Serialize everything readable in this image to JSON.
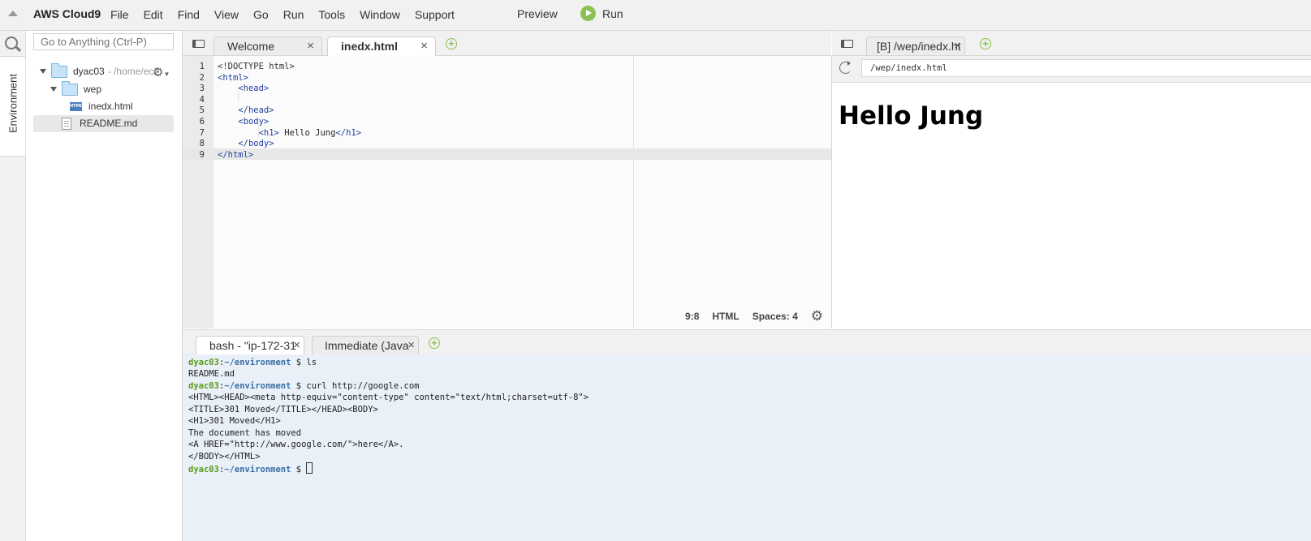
{
  "menubar": {
    "brand": "AWS Cloud9",
    "items": [
      "File",
      "Edit",
      "Find",
      "View",
      "Go",
      "Run",
      "Tools",
      "Window",
      "Support"
    ],
    "preview": "Preview",
    "run": "Run"
  },
  "sidebar": {
    "env_tab": "Environment",
    "search_placeholder": "Go to Anything (Ctrl-P)"
  },
  "tree": {
    "root_name": "dyac03",
    "root_path": "- /home/ec2",
    "folder": "wep",
    "file_html": "inedx.html",
    "file_readme": "README.md"
  },
  "editor": {
    "tabs": [
      {
        "label": "Welcome",
        "active": false
      },
      {
        "label": "inedx.html",
        "active": true
      }
    ],
    "lines": [
      {
        "n": "1",
        "text": "<!DOCTYPE html>"
      },
      {
        "n": "2",
        "text": "<html>"
      },
      {
        "n": "3",
        "text": "    <head>"
      },
      {
        "n": "4",
        "text": ""
      },
      {
        "n": "5",
        "text": "    </head>"
      },
      {
        "n": "6",
        "text": "    <body>"
      },
      {
        "n": "7",
        "text": "        <h1> Hello Jung</h1>"
      },
      {
        "n": "8",
        "text": "    </body>"
      },
      {
        "n": "9",
        "text": "</html>"
      }
    ],
    "status": {
      "position": "9:8",
      "mode": "HTML",
      "spaces": "Spaces: 4"
    }
  },
  "preview": {
    "tab_label": "[B] /wep/inedx.ht",
    "address": "/wep/inedx.html",
    "heading": "Hello Jung"
  },
  "terminal": {
    "tabs": [
      {
        "label": "bash - \"ip-172-31"
      },
      {
        "label": "Immediate (Java"
      }
    ],
    "user": "dyac03",
    "path": "~/environment",
    "lines": [
      {
        "kind": "cmd",
        "text": "ls"
      },
      {
        "kind": "out",
        "text": "README.md"
      },
      {
        "kind": "cmd",
        "text": "curl http://google.com"
      },
      {
        "kind": "out",
        "text": "<HTML><HEAD><meta http-equiv=\"content-type\" content=\"text/html;charset=utf-8\">"
      },
      {
        "kind": "out",
        "text": "<TITLE>301 Moved</TITLE></HEAD><BODY>"
      },
      {
        "kind": "out",
        "text": "<H1>301 Moved</H1>"
      },
      {
        "kind": "out",
        "text": "The document has moved"
      },
      {
        "kind": "out",
        "text": "<A HREF=\"http://www.google.com/\">here</A>."
      },
      {
        "kind": "out",
        "text": "</BODY></HTML>"
      },
      {
        "kind": "cmd",
        "text": ""
      }
    ]
  },
  "colors": {
    "accent_green": "#8cc152",
    "terminal_bg": "#e9f0f8",
    "prompt_user": "#5a9a1a",
    "prompt_path": "#3a6ea5",
    "tag_color": "#1f3f9f"
  }
}
